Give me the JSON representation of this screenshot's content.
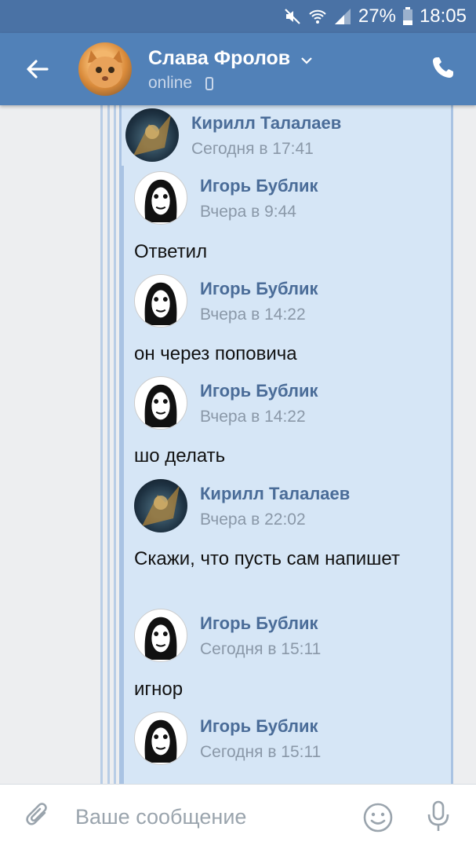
{
  "status_bar": {
    "battery": "27%",
    "time": "18:05",
    "icons": [
      "mute-icon",
      "wifi-icon",
      "signal-icon",
      "battery-icon"
    ]
  },
  "header": {
    "name": "Слава Фролов",
    "status": "online",
    "icons": [
      "back-arrow-icon",
      "chevron-down-icon",
      "mobile-icon",
      "phone-icon"
    ]
  },
  "messages": [
    {
      "name": "Кирилл Талалаев",
      "time": "Сегодня в 17:41",
      "avatar": "kirill"
    },
    {
      "name": "Игорь Бублик",
      "time": "Вчера в 9:44",
      "text": "Ответил",
      "avatar": "igor"
    },
    {
      "name": "Игорь Бублик",
      "time": "Вчера в 14:22",
      "text": "он через поповича",
      "avatar": "igor"
    },
    {
      "name": "Игорь Бублик",
      "time": "Вчера в 14:22",
      "text": "шо делать",
      "avatar": "igor"
    },
    {
      "name": "Кирилл Талалаев",
      "time": "Вчера в 22:02",
      "text": "Скажи, что пусть сам напишет",
      "avatar": "kirill"
    },
    {
      "name": "Игорь Бублик",
      "time": "Сегодня в 15:11",
      "text": "игнор",
      "avatar": "igor"
    },
    {
      "name": "Игорь Бублик",
      "time": "Сегодня в 15:11",
      "avatar": "igor"
    }
  ],
  "input": {
    "placeholder": "Ваше сообщение",
    "icons": [
      "paperclip-icon",
      "emoji-icon",
      "microphone-icon"
    ]
  },
  "colors": {
    "header": "#5181b8",
    "status_bar": "#4a72a5",
    "bubble": "#d6e6f6",
    "sender_name": "#4a6c98"
  }
}
